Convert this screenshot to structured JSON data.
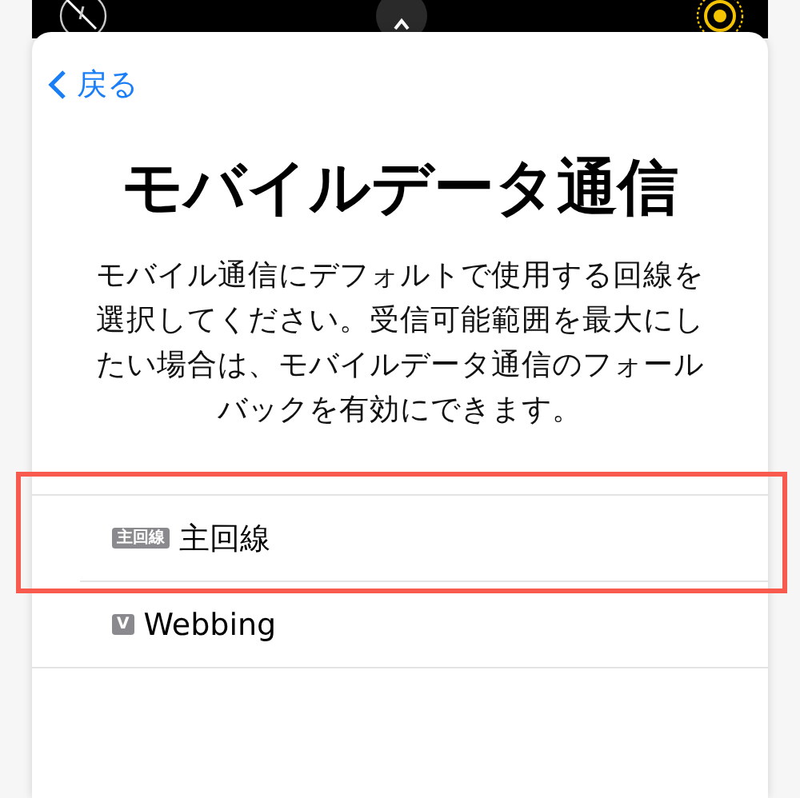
{
  "nav": {
    "back_label": "戻る"
  },
  "title": "モバイルデータ通信",
  "description": "モバイル通信にデフォルトで使用する回線を選択してください。受信可能範囲を最大にしたい場合は、モバイルデータ通信のフォールバックを有効にできます。",
  "lines": [
    {
      "badge": "主回線",
      "label": "主回線",
      "highlighted": true
    },
    {
      "badge": "V",
      "label": "Webbing",
      "highlighted": false
    }
  ]
}
